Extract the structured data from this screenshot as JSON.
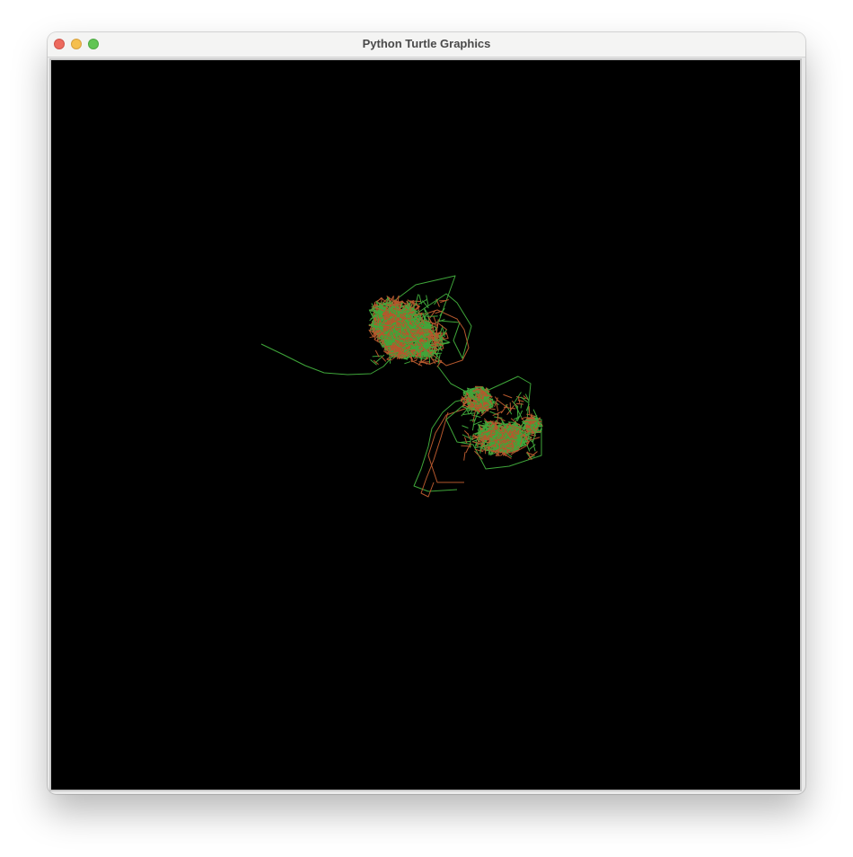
{
  "window": {
    "title": "Python Turtle Graphics"
  },
  "colors": {
    "canvas_background": "#000000",
    "trail_green": "#3fa63a",
    "trail_orange": "#b5582d",
    "close": "#ed6a5e",
    "minimize": "#f5bf4f",
    "maximize": "#61c554"
  },
  "icons": [
    "close-button",
    "minimize-button",
    "maximize-button"
  ]
}
